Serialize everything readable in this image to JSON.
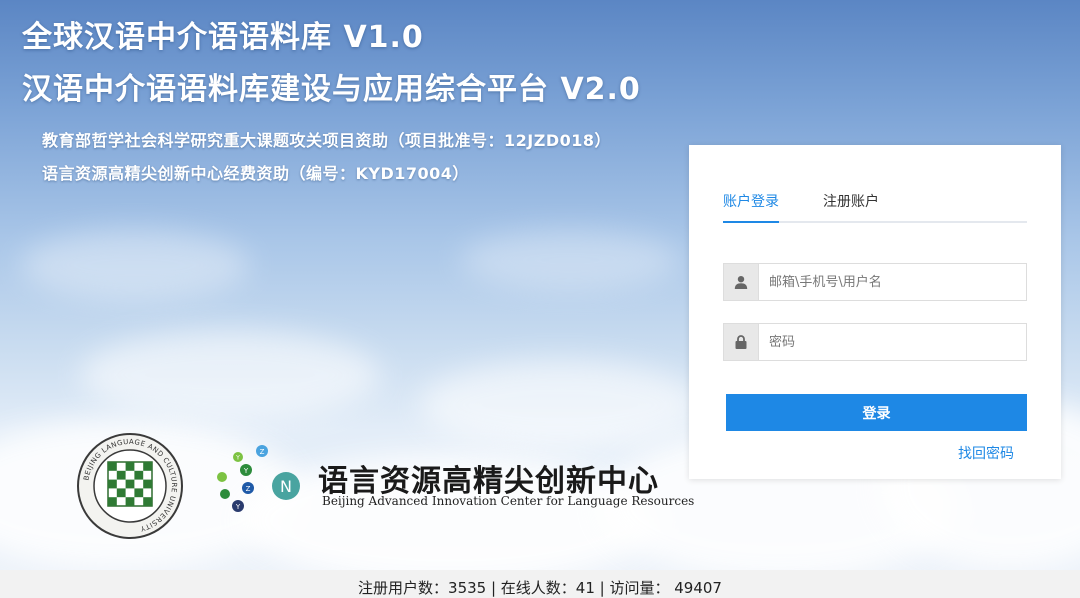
{
  "header": {
    "title_line1": "全球汉语中介语语料库 V1.0",
    "title_line2": "汉语中介语语料库建设与应用综合平台 V2.0",
    "funding_line1": "教育部哲学社会科学研究重大课题攻关项目资助（项目批准号：12JZD018）",
    "funding_line2": "语言资源高精尖创新中心经费资助（编号：KYD17004）"
  },
  "logos": {
    "center_name_cn": "语言资源高精尖创新中心",
    "center_name_en": "Beijing Advanced Innovation Center for Language Resources",
    "center_letters": [
      "Y",
      "Z",
      "N",
      "Y",
      "Z",
      "Y"
    ],
    "blcu_ring_text": "BEIJING LANGUAGE AND CULTURE UNIVERSITY"
  },
  "login": {
    "tabs": [
      {
        "label": "账户登录",
        "active": true
      },
      {
        "label": "注册账户",
        "active": false
      }
    ],
    "username_placeholder": "邮箱\\手机号\\用户名",
    "password_placeholder": "密码",
    "submit_label": "登录",
    "forgot_label": "找回密码"
  },
  "footer": {
    "stats": "注册用户数：3535 | 在线人数：41 | 访问量： 49407"
  },
  "colors": {
    "accent": "#1e88e5",
    "sky_top": "#5b86c4",
    "panel": "#ffffff"
  }
}
